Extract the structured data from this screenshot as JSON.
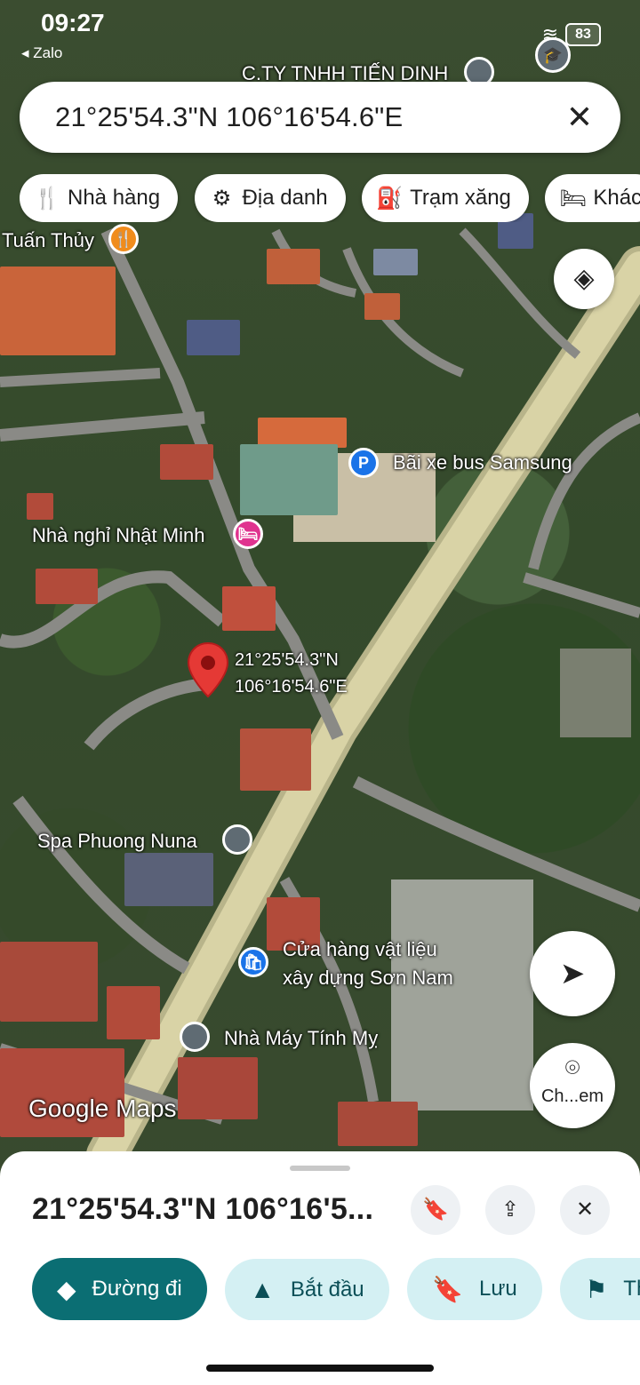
{
  "status_bar": {
    "time": "09:27",
    "back_app": "◂ Zalo",
    "battery": "83"
  },
  "search": {
    "query": "21°25'54.3\"N 106°16'54.6\"E"
  },
  "chips": [
    {
      "icon": "🍴",
      "label": "Nhà hàng"
    },
    {
      "icon": "⚙",
      "label": "Địa danh"
    },
    {
      "icon": "⛽",
      "label": "Trạm xăng"
    },
    {
      "icon": "🛏",
      "label": "Khác"
    }
  ],
  "map": {
    "labels": {
      "company": "C.TY TNHH TIẾN DINH",
      "restaurant": "Tuấn Thủy",
      "bus_parking": "Bãi xe bus Samsung",
      "guesthouse": "Nhà nghỉ Nhật Minh",
      "pin_lat": "21°25'54.3\"N",
      "pin_lon": "106°16'54.6\"E",
      "spa": "Spa Phuong Nuna",
      "store_line1": "Cửa hàng vật liệu",
      "store_line2": "xây dựng Sơn Nam",
      "factory": "Nhà Máy Tính Mỵ",
      "watermark": "Google Maps",
      "parking_icon": "P"
    },
    "street_view_label": "Ch...em"
  },
  "sheet": {
    "title": "21°25'54.3\"N 106°16'5...",
    "actions": [
      {
        "icon": "◆",
        "label": "Đường đi"
      },
      {
        "icon": "▲",
        "label": "Bắt đầu"
      },
      {
        "icon": "🔖",
        "label": "Lưu"
      },
      {
        "icon": "⚑",
        "label": "Th"
      }
    ]
  },
  "colors": {
    "primary": "#0b6e73",
    "secondary_bg": "#d4f0f3",
    "pin_red": "#e53935",
    "poi_pink": "#e0338f",
    "poi_blue": "#1a73e8",
    "poi_orange": "#f08c1c"
  }
}
